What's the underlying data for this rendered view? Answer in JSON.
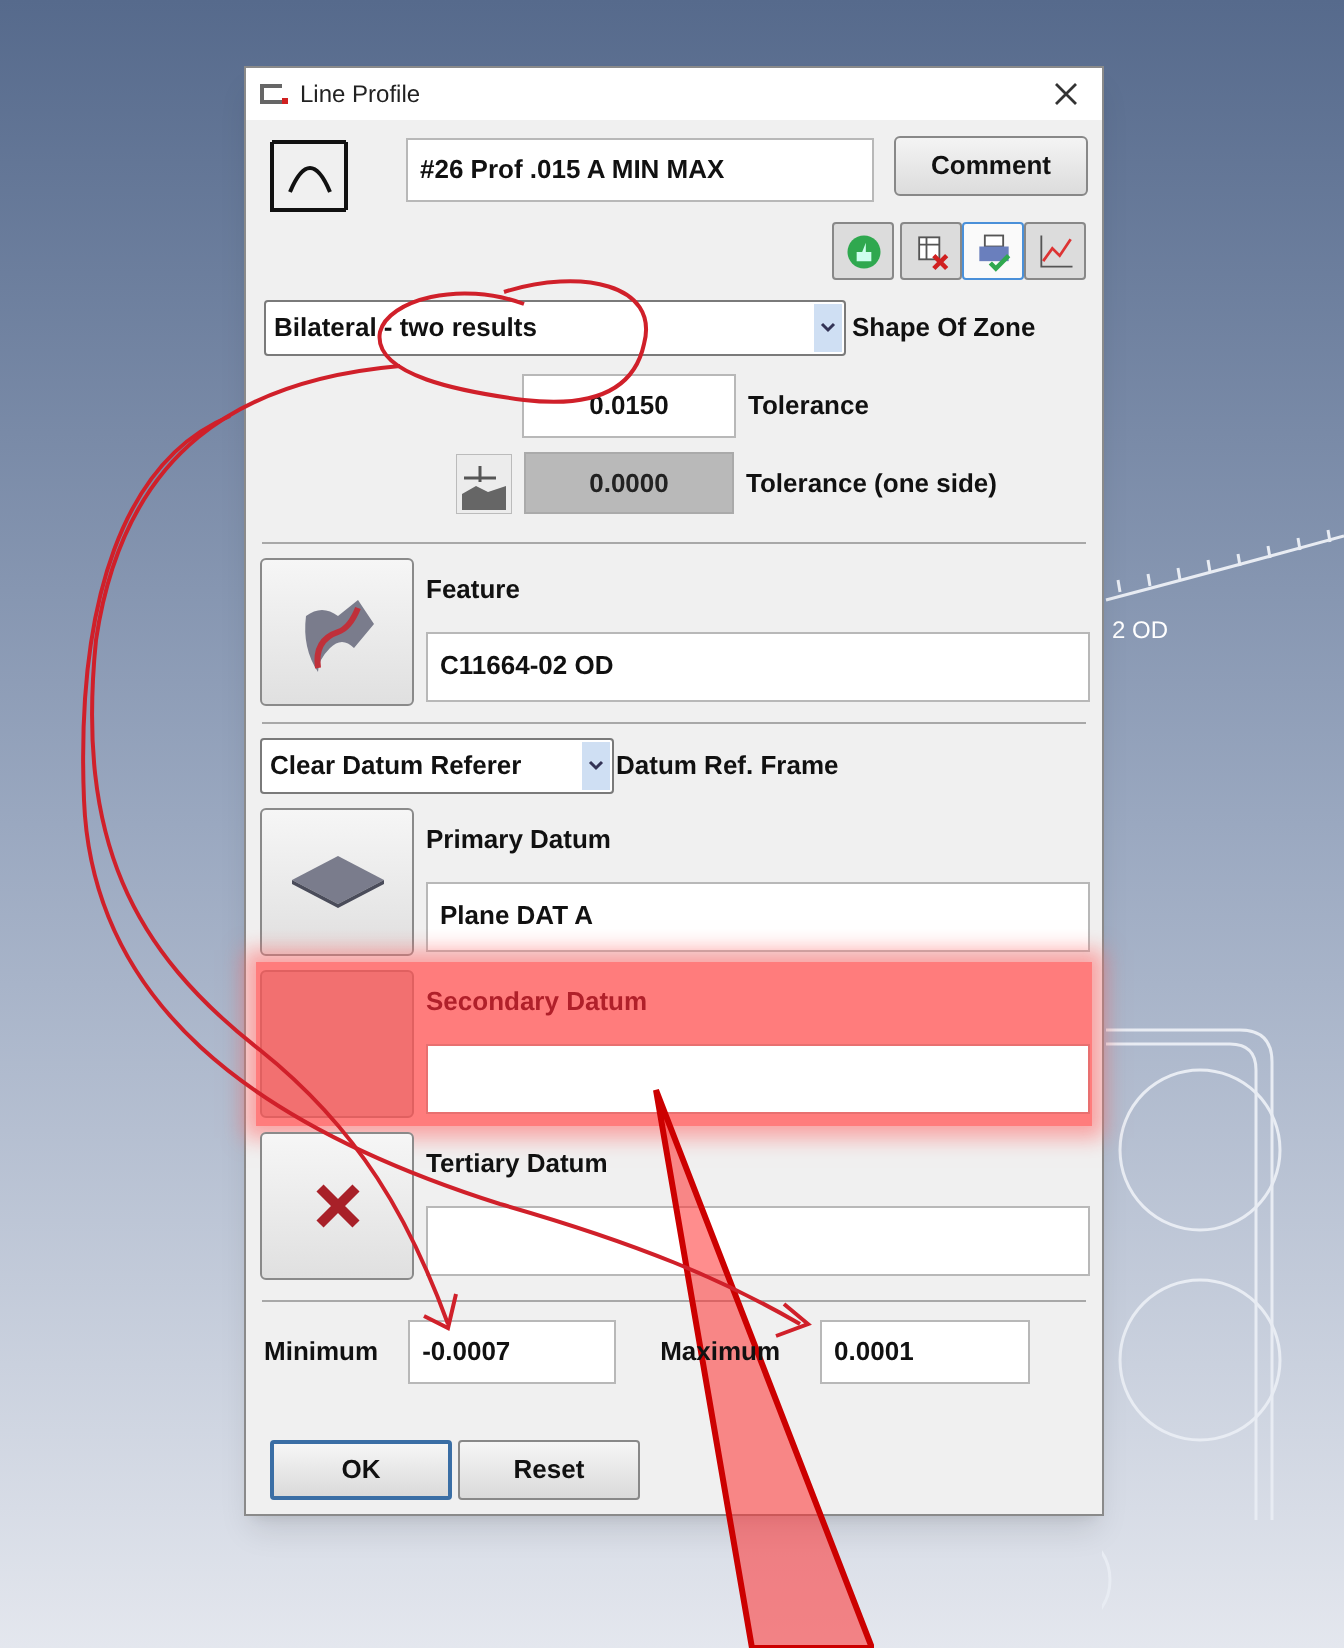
{
  "window": {
    "title": "Line Profile"
  },
  "canvas_text": "2 OD",
  "name_field": {
    "value": "#26 Prof .015 A MIN MAX"
  },
  "comment_button": "Comment",
  "toolbar": [
    {
      "selected": false
    },
    {
      "selected": false
    },
    {
      "selected": true
    },
    {
      "selected": false
    }
  ],
  "shape_of_zone": {
    "value": "Bilateral - two results",
    "label": "Shape Of Zone"
  },
  "tolerance": {
    "value": "0.0150",
    "label": "Tolerance"
  },
  "tolerance_one_side": {
    "value": "0.0000",
    "label": "Tolerance (one side)",
    "disabled": true
  },
  "feature": {
    "label": "Feature",
    "value": "C11664-02 OD"
  },
  "datum_ref_frame": {
    "value": "Clear Datum Referer",
    "label": "Datum Ref. Frame"
  },
  "datums": [
    {
      "label": "Primary Datum",
      "value": "Plane DAT A",
      "kind": "plane",
      "highlighted": false
    },
    {
      "label": "Secondary Datum",
      "kind": "empty",
      "highlighted": true
    },
    {
      "label": "Tertiary Datum",
      "kind": "cleared",
      "highlighted": false
    }
  ],
  "minimum": {
    "label": "Minimum",
    "value": "-0.0007"
  },
  "maximum": {
    "label": "Maximum",
    "value": "0.0001"
  },
  "buttons": [
    "OK",
    "Reset"
  ]
}
